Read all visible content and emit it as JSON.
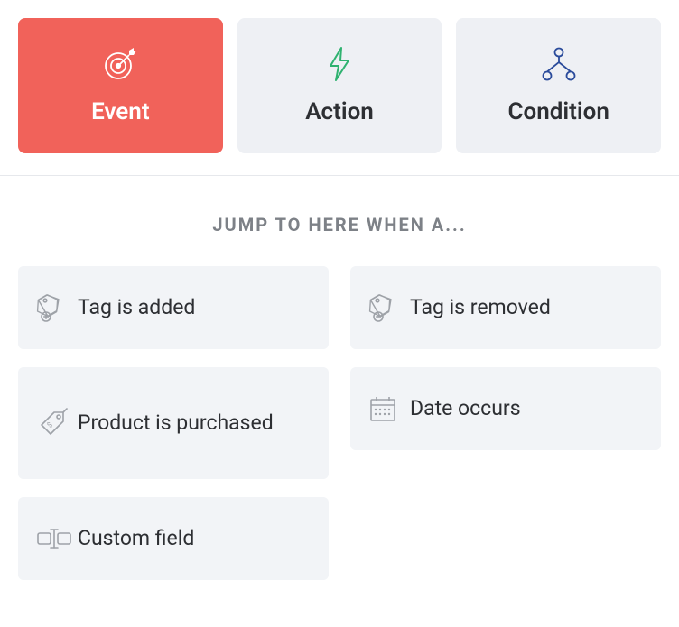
{
  "tabs": [
    {
      "label": "Event",
      "icon": "target-icon",
      "active": true
    },
    {
      "label": "Action",
      "icon": "lightning-icon",
      "active": false
    },
    {
      "label": "Condition",
      "icon": "branch-icon",
      "active": false
    }
  ],
  "section_title": "JUMP TO HERE WHEN A...",
  "events": [
    {
      "label": "Tag is added",
      "icon": "tag-add-icon"
    },
    {
      "label": "Tag is removed",
      "icon": "tag-remove-icon"
    },
    {
      "label": "Product is purchased",
      "icon": "price-tag-icon"
    },
    {
      "label": "Date occurs",
      "icon": "calendar-icon"
    },
    {
      "label": "Custom field",
      "icon": "text-field-icon"
    }
  ],
  "colors": {
    "accent": "#f1625a",
    "card": "#f2f4f7",
    "tab_inactive": "#eef0f4",
    "text": "#2d2f33",
    "muted": "#7d8187",
    "icon": "#9ea2a8",
    "action_icon": "#2fb270",
    "condition_icon": "#2a4b9b"
  }
}
